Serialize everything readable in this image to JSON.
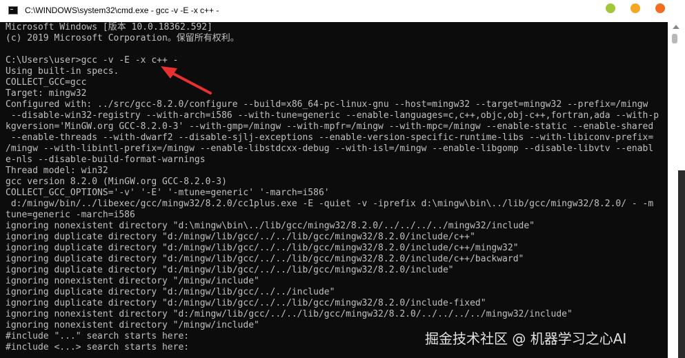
{
  "window": {
    "title": "C:\\WINDOWS\\system32\\cmd.exe - gcc  -v -E -x c++ -",
    "icon": "cmd-icon",
    "buttons": {
      "minimize_color": "#a3c73b",
      "maximize_color": "#f5a623",
      "close_color": "#f36c21"
    }
  },
  "terminal": {
    "colors": {
      "background": "#0c0c0c",
      "text": "#c0c0c0"
    },
    "lines": [
      "Microsoft Windows [版本 10.0.18362.592]",
      "(c) 2019 Microsoft Corporation。保留所有权利。",
      "",
      "C:\\Users\\user>gcc -v -E -x c++ -",
      "Using built-in specs.",
      "COLLECT_GCC=gcc",
      "Target: mingw32",
      "Configured with: ../src/gcc-8.2.0/configure --build=x86_64-pc-linux-gnu --host=mingw32 --target=mingw32 --prefix=/mingw",
      " --disable-win32-registry --with-arch=i586 --with-tune=generic --enable-languages=c,c++,objc,obj-c++,fortran,ada --with-p",
      "kgversion='MinGW.org GCC-8.2.0-3' --with-gmp=/mingw --with-mpfr=/mingw --with-mpc=/mingw --enable-static --enable-shared",
      " --enable-threads --with-dwarf2 --disable-sjlj-exceptions --enable-version-specific-runtime-libs --with-libiconv-prefix=",
      "/mingw --with-libintl-prefix=/mingw --enable-libstdcxx-debug --with-isl=/mingw --enable-libgomp --disable-libvtv --enabl",
      "e-nls --disable-build-format-warnings",
      "Thread model: win32",
      "gcc version 8.2.0 (MinGW.org GCC-8.2.0-3)",
      "COLLECT_GCC_OPTIONS='-v' '-E' '-mtune=generic' '-march=i586'",
      " d:/mingw/bin/../libexec/gcc/mingw32/8.2.0/cc1plus.exe -E -quiet -v -iprefix d:\\mingw\\bin\\../lib/gcc/mingw32/8.2.0/ - -m",
      "tune=generic -march=i586",
      "ignoring nonexistent directory \"d:\\mingw\\bin\\../lib/gcc/mingw32/8.2.0/../../../../mingw32/include\"",
      "ignoring duplicate directory \"d:/mingw/lib/gcc/../../lib/gcc/mingw32/8.2.0/include/c++\"",
      "ignoring duplicate directory \"d:/mingw/lib/gcc/../../lib/gcc/mingw32/8.2.0/include/c++/mingw32\"",
      "ignoring duplicate directory \"d:/mingw/lib/gcc/../../lib/gcc/mingw32/8.2.0/include/c++/backward\"",
      "ignoring duplicate directory \"d:/mingw/lib/gcc/../../lib/gcc/mingw32/8.2.0/include\"",
      "ignoring nonexistent directory \"/mingw/include\"",
      "ignoring duplicate directory \"d:/mingw/lib/gcc/../../include\"",
      "ignoring duplicate directory \"d:/mingw/lib/gcc/../../lib/gcc/mingw32/8.2.0/include-fixed\"",
      "ignoring nonexistent directory \"d:/mingw/lib/gcc/../../lib/gcc/mingw32/8.2.0/../../../../mingw32/include\"",
      "ignoring nonexistent directory \"/mingw/include\"",
      "#include \"...\" search starts here:",
      "#include <...> search starts here:"
    ]
  },
  "annotation": {
    "color": "#e8312f"
  },
  "watermark": {
    "text": "掘金技术社区 @ 机器学习之心AI"
  }
}
